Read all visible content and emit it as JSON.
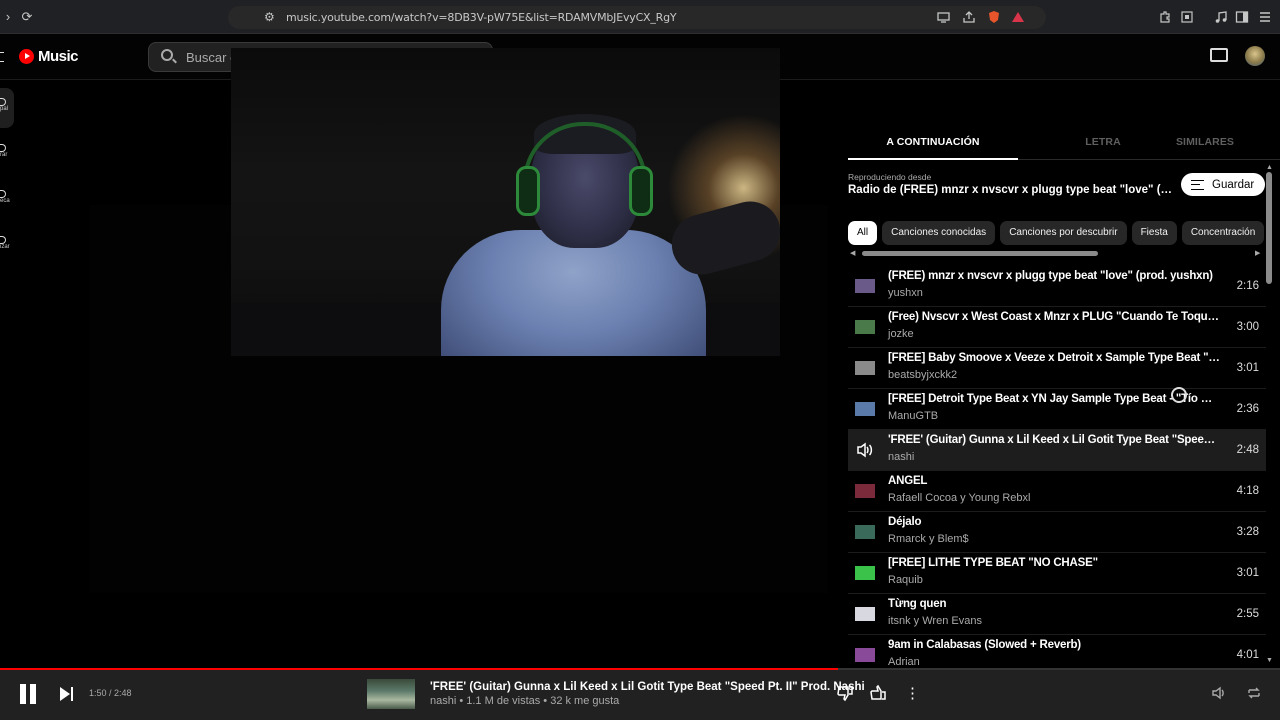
{
  "browser": {
    "url": "music.youtube.com/watch?v=8DB3V-pW75E&list=RDAMVMbJEvyCX_RgY"
  },
  "header": {
    "logo_text": "Music",
    "search_placeholder": "Buscar c"
  },
  "rail": {
    "items": [
      {
        "label": "pal"
      },
      {
        "label": "rar"
      },
      {
        "label": "eca"
      },
      {
        "label": "izar"
      }
    ]
  },
  "panel": {
    "tabs": [
      {
        "label": "A CONTINUACIÓN",
        "active": true
      },
      {
        "label": "LETRA",
        "active": false
      },
      {
        "label": "SIMILARES",
        "active": false
      }
    ],
    "playing_from_label": "Reproduciendo desde",
    "playing_from_title": "Radio de (FREE) mnzr x nvscvr x plugg type beat \"love\" (prod. yushxn)",
    "save_label": "Guardar",
    "chips": [
      "All",
      "Canciones conocidas",
      "Canciones por descubrir",
      "Fiesta",
      "Concentración"
    ],
    "queue": [
      {
        "title": "(FREE) mnzr x nvscvr x plugg type beat \"love\" (prod. yushxn)",
        "artist": "yushxn",
        "duration": "2:16",
        "thumb_color": "#6a5a8a"
      },
      {
        "title": "(Free) Nvscvr x West Coast x Mnzr x PLUG \"Cuando Te Toque\" | ...",
        "artist": "jozke",
        "duration": "3:00",
        "thumb_color": "#4a7a4a"
      },
      {
        "title": "[FREE] Baby Smoove x Veeze x Detroit x Sample Type Beat \"Blu...",
        "artist": "beatsbyjxckk2",
        "duration": "3:01",
        "thumb_color": "#8a8a8a"
      },
      {
        "title": "[FREE] Detroit Type Beat x YN Jay Sample Type Beat - \"Tío De J...",
        "artist": "ManuGTB",
        "duration": "2:36",
        "thumb_color": "#5a7aaa"
      },
      {
        "title": "'FREE' (Guitar) Gunna x Lil Keed x Lil Gotit Type Beat \"Speed Pt...",
        "artist": "nashi",
        "duration": "2:48",
        "current": true
      },
      {
        "title": "ÁNGEL",
        "artist": "Rafaell Cocoa y Young Rebxl",
        "duration": "4:18",
        "thumb_color": "#7a2a3a"
      },
      {
        "title": "Déjalo",
        "artist": "Rmarck y Blem$",
        "duration": "3:28",
        "thumb_color": "#3a6a5a"
      },
      {
        "title": "[FREE] LITHE TYPE BEAT \"NO CHASE\"",
        "artist": "Raquib",
        "duration": "3:01",
        "thumb_color": "#3ac24a"
      },
      {
        "title": "Từng quen",
        "artist": "itsnk y Wren Evans",
        "duration": "2:55",
        "thumb_color": "#d8d8e0"
      },
      {
        "title": "9am in Calabasas (Slowed + Reverb)",
        "artist": "Adrian",
        "duration": "4:01",
        "thumb_color": "#8a4a9a"
      }
    ]
  },
  "player": {
    "time": "1:50 / 2:48",
    "progress": 0.655,
    "title": "'FREE' (Guitar) Gunna x Lil Keed x Lil Gotit Type Beat \"Speed Pt. II\" Prod. Nashi",
    "meta": "nashi • 1.1 M de vistas • 32 k me gusta"
  }
}
